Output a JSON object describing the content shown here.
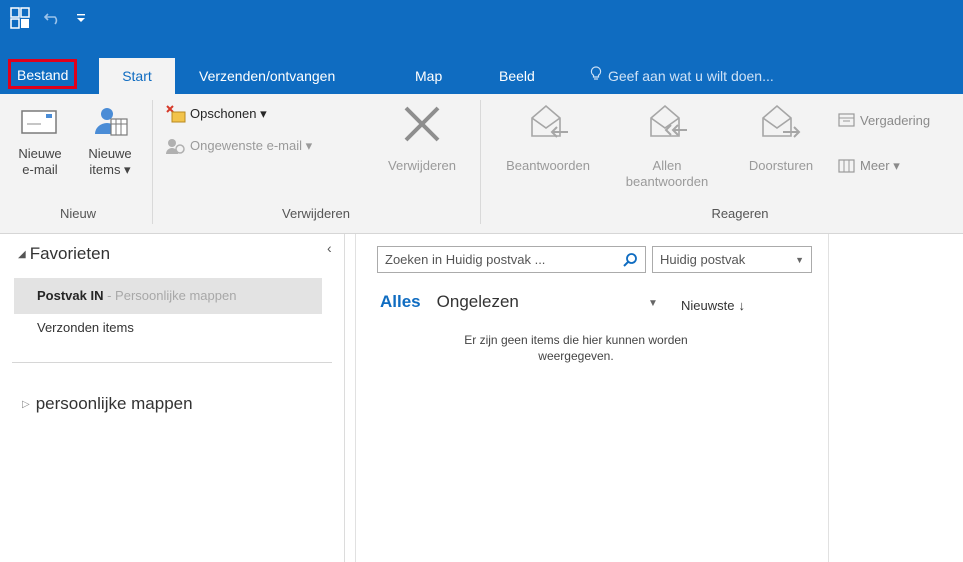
{
  "colors": {
    "accent": "#0f6cc1",
    "highlight": "#e0001b",
    "ribbon_bg": "#f3f3f3"
  },
  "tabs": {
    "bestand": "Bestand",
    "start": "Start",
    "send_receive": "Verzenden/ontvangen",
    "map": "Map",
    "beeld": "Beeld",
    "tell_me": "Geef aan wat u wilt doen..."
  },
  "ribbon": {
    "new_group": {
      "label": "Nieuw",
      "new_email_l1": "Nieuwe",
      "new_email_l2": "e-mail",
      "new_items_l1": "Nieuwe",
      "new_items_l2": "items ▾"
    },
    "delete_group": {
      "label": "Verwijderen",
      "cleanup": "Opschonen ▾",
      "junk": "Ongewenste e-mail ▾",
      "delete": "Verwijderen"
    },
    "respond_group": {
      "label": "Reageren",
      "reply": "Beantwoorden",
      "reply_all_l1": "Allen",
      "reply_all_l2": "beantwoorden",
      "forward": "Doorsturen",
      "meeting": "Vergadering",
      "more": "Meer ▾"
    }
  },
  "folders": {
    "favorites": "Favorieten",
    "inbox": "Postvak IN",
    "inbox_sub": " - Persoonlijke mappen",
    "sent": "Verzonden items",
    "personal": "persoonlijke mappen"
  },
  "list": {
    "search_placeholder": "Zoeken in Huidig postvak ...",
    "scope": "Huidig postvak",
    "filter_all": "Alles",
    "filter_unread": "Ongelezen",
    "sort": "Nieuwste",
    "empty_l1": "Er zijn geen items die hier kunnen worden",
    "empty_l2": "weergegeven."
  }
}
